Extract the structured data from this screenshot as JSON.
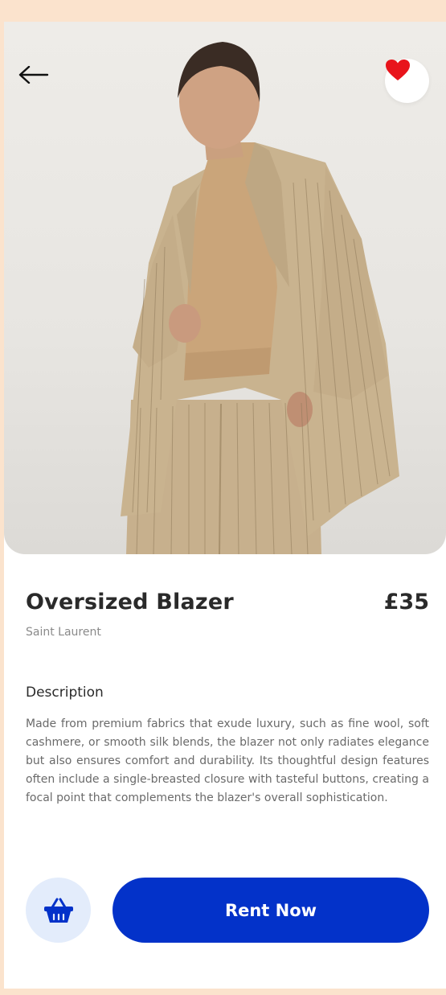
{
  "product": {
    "name": "Oversized Blazer",
    "price": "£35",
    "brand": "Saint Laurent"
  },
  "description": {
    "heading": "Description",
    "body": "Made from premium fabrics that exude luxury, such as fine wool, soft cashmere, or smooth silk blends, the blazer not only radiates elegance but also ensures comfort and durability. Its thoughtful design features often include a single-breasted closure with tasteful buttons, creating a focal point that complements the blazer's overall sophistication."
  },
  "actions": {
    "rent_label": "Rent Now"
  },
  "icons": {
    "back": "arrow-left-icon",
    "favorite": "heart-icon",
    "cart": "basket-icon"
  },
  "colors": {
    "accent": "#0332c9",
    "accent_light": "#e3ecfb",
    "favorite": "#e8141b",
    "background": "#fbe3cd"
  }
}
